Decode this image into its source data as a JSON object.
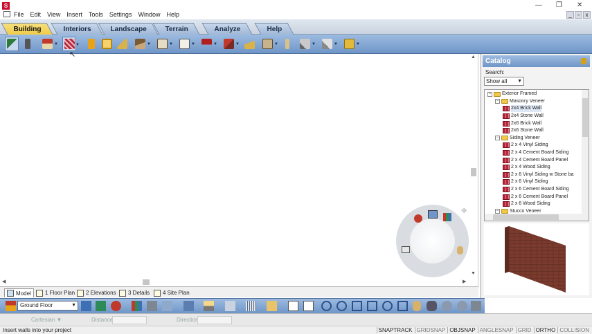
{
  "menu": {
    "items": [
      "File",
      "Edit",
      "View",
      "Insert",
      "Tools",
      "Settings",
      "Window",
      "Help"
    ]
  },
  "tabs": [
    "Building",
    "Interiors",
    "Landscape",
    "Terrain",
    "Analyze",
    "Help"
  ],
  "active_tab": "Building",
  "toolbar_icons": [
    "select-pointer-icon",
    "paintbrush-icon",
    "roof-house-icon",
    "wall-tool-icon",
    "door-icon",
    "window-icon",
    "stairs-icon",
    "floor-icon",
    "cabinet-icon",
    "ceiling-icon",
    "roof-red-icon",
    "dormer-icon",
    "railing-icon",
    "deck-icon",
    "column-icon",
    "framing-icon",
    "foundation-icon",
    "molding-icon"
  ],
  "layout_tabs": [
    "Model",
    "1 Floor Plan",
    "2 Elevations",
    "3 Details",
    "4 Site Plan"
  ],
  "active_layout_tab": "Model",
  "floor_select": "Ground Floor",
  "input_row": {
    "mode": "Cartesian",
    "distance_label": "Distance",
    "direction_label": "Direction"
  },
  "status": {
    "message": "Insert walls into your project",
    "flags": [
      "SNAPTRACK",
      "GRIDSNAP",
      "OBJSNAP",
      "ANGLESNAP",
      "GRID",
      "ORTHO",
      "COLLISION"
    ],
    "flags_on": [
      "SNAPTRACK",
      "OBJSNAP",
      "ORTHO"
    ]
  },
  "catalog": {
    "title": "Catalog",
    "search_label": "Search:",
    "search_value": "Show all",
    "tree": [
      {
        "label": "Exterior Framed",
        "level": 0,
        "kind": "folder"
      },
      {
        "label": "Masonry Veneer",
        "level": 1,
        "kind": "folder"
      },
      {
        "label": "2x4  Brick Wall",
        "level": 2,
        "kind": "wall",
        "selected": true
      },
      {
        "label": "2x4 Stone Wall",
        "level": 2,
        "kind": "wall"
      },
      {
        "label": "2x6 Brick Wall",
        "level": 2,
        "kind": "wall"
      },
      {
        "label": "2x6 Stone Wall",
        "level": 2,
        "kind": "wall"
      },
      {
        "label": "Siding Veneer",
        "level": 1,
        "kind": "folder"
      },
      {
        "label": "2 x 4 Vinyl Siding",
        "level": 2,
        "kind": "wall"
      },
      {
        "label": "2 x 4 Cement Board Siding",
        "level": 2,
        "kind": "wall"
      },
      {
        "label": "2 x 4 Cement Board Panel",
        "level": 2,
        "kind": "wall"
      },
      {
        "label": "2 x 4 Wood Siding",
        "level": 2,
        "kind": "wall"
      },
      {
        "label": "2 x 6 Vinyl Siding w Stone ba",
        "level": 2,
        "kind": "wall"
      },
      {
        "label": "2 x 6 Vinyl Siding",
        "level": 2,
        "kind": "wall"
      },
      {
        "label": "2 x 6 Cement Board Siding",
        "level": 2,
        "kind": "wall"
      },
      {
        "label": "2 x 6 Cement Board Panel",
        "level": 2,
        "kind": "wall"
      },
      {
        "label": "2 x 6 Wood Siding",
        "level": 2,
        "kind": "wall"
      },
      {
        "label": "Stucco Veneer",
        "level": 1,
        "kind": "folder"
      }
    ]
  },
  "colors": {
    "toolbar": "#7ea3d3",
    "active_tab": "#f0cb47",
    "brick": "#7a3a2e"
  }
}
